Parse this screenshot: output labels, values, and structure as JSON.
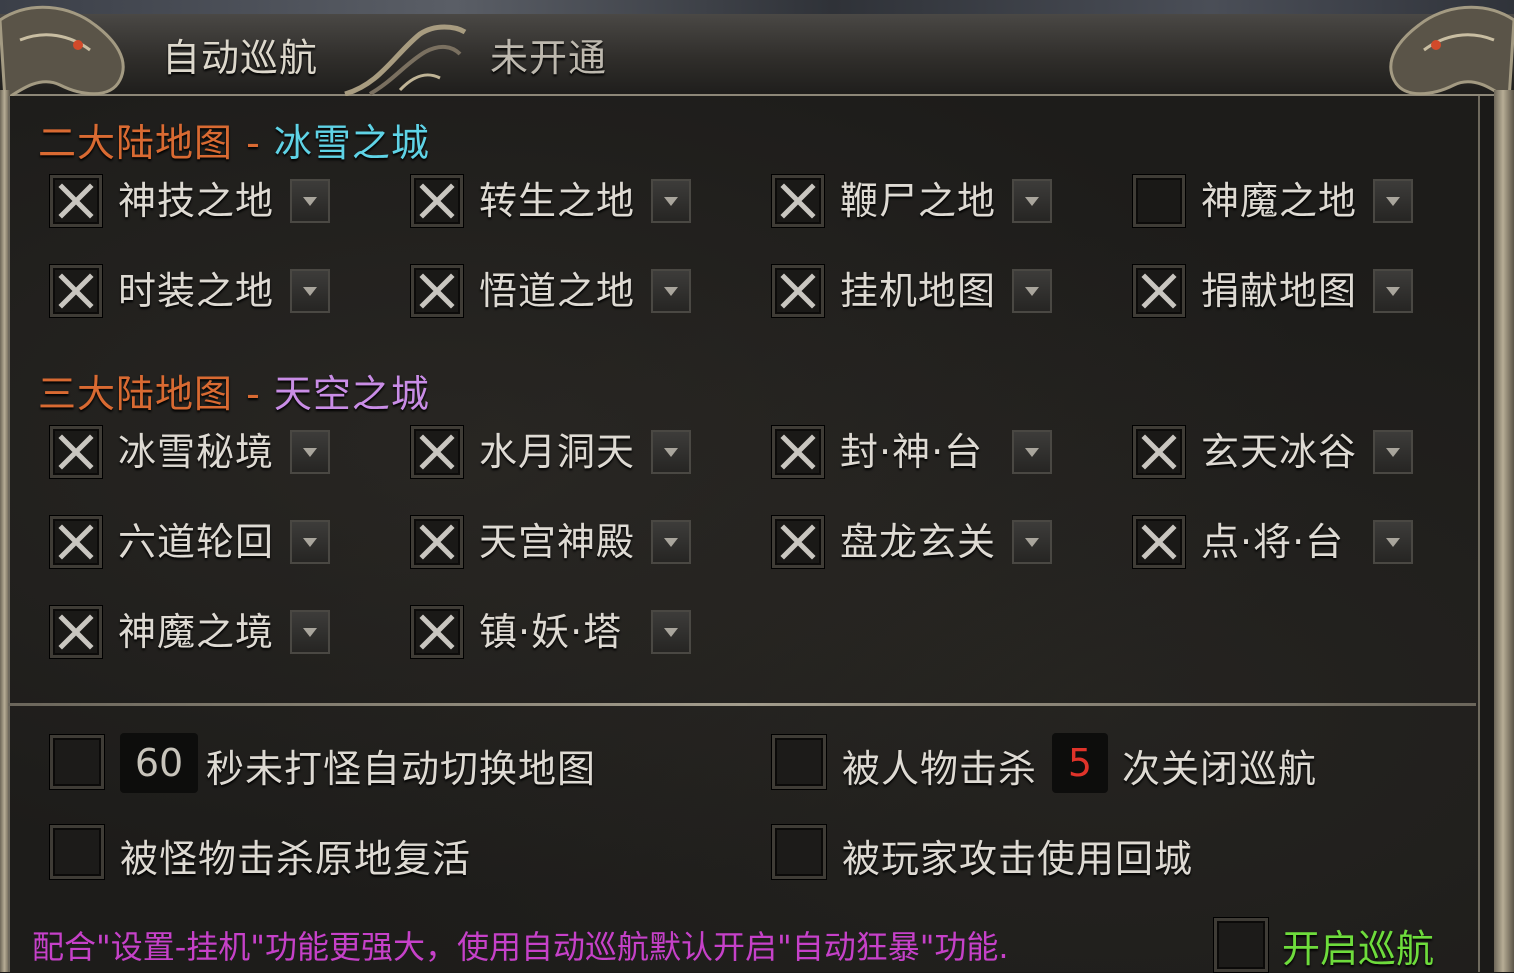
{
  "tabs": [
    {
      "label": "自动巡航",
      "active": true
    },
    {
      "label": "未开通",
      "active": false
    }
  ],
  "section2": {
    "prefix": "二大陆地图",
    "sep": " - ",
    "city": "冰雪之城",
    "items": [
      {
        "label": "神技之地",
        "checked": true
      },
      {
        "label": "转生之地",
        "checked": true
      },
      {
        "label": "鞭尸之地",
        "checked": true
      },
      {
        "label": "神魔之地",
        "checked": false
      },
      {
        "label": "时装之地",
        "checked": true
      },
      {
        "label": "悟道之地",
        "checked": true
      },
      {
        "label": "挂机地图",
        "checked": true
      },
      {
        "label": "捐献地图",
        "checked": true
      }
    ]
  },
  "section3": {
    "prefix": "三大陆地图",
    "sep": " - ",
    "city": "天空之城",
    "items": [
      {
        "label": "冰雪秘境",
        "checked": true
      },
      {
        "label": "水月洞天",
        "checked": true
      },
      {
        "label": "封·神·台",
        "checked": true
      },
      {
        "label": "玄天冰谷",
        "checked": true
      },
      {
        "label": "六道轮回",
        "checked": true
      },
      {
        "label": "天宫神殿",
        "checked": true
      },
      {
        "label": "盘龙玄关",
        "checked": true
      },
      {
        "label": "点·将·台",
        "checked": true
      },
      {
        "label": "神魔之境",
        "checked": true
      },
      {
        "label": "镇·妖·塔",
        "checked": true
      }
    ]
  },
  "options": {
    "switch_seconds": "60",
    "switch_text": "秒未打怪自动切换地图",
    "killed_by_player_prefix": "被人物击杀",
    "killed_count": "5",
    "killed_by_player_suffix": "次关闭巡航",
    "revive_text": "被怪物击杀原地复活",
    "attacked_text": "被玩家攻击使用回城"
  },
  "footer": {
    "note": "配合\"设置-挂机\"功能更强大，使用自动巡航默认开启\"自动狂暴\"功能.",
    "start_label": "开启巡航"
  },
  "colors": {
    "section_prefix": "#d96a32",
    "city_ice": "#5fd3e6",
    "city_sky": "#c98de6",
    "note": "#c641c9",
    "start": "#6edc3c",
    "count_red": "#e0332a"
  },
  "icons": {
    "checked": "x-mark-icon",
    "dropdown": "triangle-down-icon",
    "ornament": "dragon-ornament-icon"
  }
}
